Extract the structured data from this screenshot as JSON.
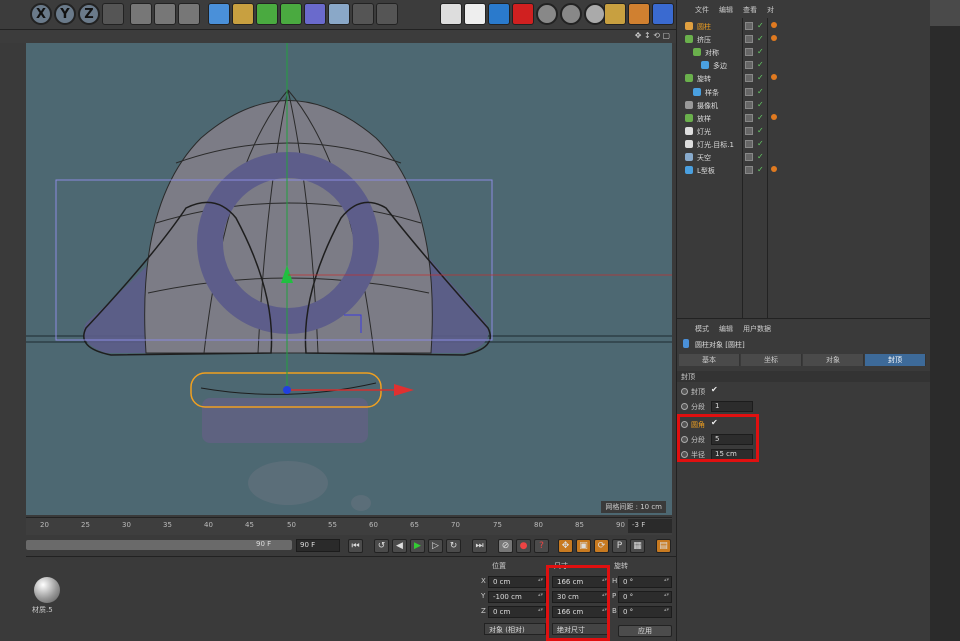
{
  "toolbar": {
    "axis_buttons": [
      "X",
      "Y",
      "Z"
    ]
  },
  "viewport": {
    "grid_spacing_label": "网格间距 : 10 cm"
  },
  "timeline": {
    "ticks": [
      "20",
      "25",
      "30",
      "35",
      "40",
      "45",
      "50",
      "55",
      "60",
      "65",
      "70",
      "75",
      "80",
      "85",
      "90"
    ],
    "current_frame": "-3 F",
    "end_frame_scrub": "90 F",
    "end_frame_field": "90 F"
  },
  "material": {
    "name": "材质.5"
  },
  "coordinates": {
    "headers": {
      "position": "位置",
      "size": "尺寸",
      "rotation": "旋转"
    },
    "axes": [
      "X",
      "Y",
      "Z"
    ],
    "position": [
      "0 cm",
      "-100 cm",
      "0 cm"
    ],
    "size": [
      "166 cm",
      "30 cm",
      "166 cm"
    ],
    "rotation_axes": [
      "H",
      "P",
      "B"
    ],
    "rotation": [
      "0 °",
      "0 °",
      "0 °"
    ],
    "mode_dropdown": "对象 (相对)",
    "size_dropdown": "绝对尺寸",
    "apply_label": "应用"
  },
  "object_manager": {
    "menu": [
      "文件",
      "编辑",
      "查看",
      "对"
    ],
    "objects": [
      {
        "name": "圆柱",
        "indent": 0,
        "color": "#e0a040"
      },
      {
        "name": "挤压",
        "indent": 0,
        "color": "#6ab04c"
      },
      {
        "name": "对称",
        "indent": 1,
        "color": "#6ab04c"
      },
      {
        "name": "多边",
        "indent": 2,
        "color": "#4aa0e0"
      },
      {
        "name": "旋转",
        "indent": 0,
        "color": "#6ab04c"
      },
      {
        "name": "样条",
        "indent": 1,
        "color": "#4aa0e0"
      },
      {
        "name": "摄像机",
        "indent": 0,
        "color": "#999999"
      },
      {
        "name": "放样",
        "indent": 0,
        "color": "#6ab04c"
      },
      {
        "name": "灯光",
        "indent": 0,
        "color": "#dddddd"
      },
      {
        "name": "灯光.目标.1",
        "indent": 0,
        "color": "#dddddd"
      },
      {
        "name": "天空",
        "indent": 0,
        "color": "#88aacc"
      },
      {
        "name": "L型板",
        "indent": 0,
        "color": "#4aa0e0"
      }
    ]
  },
  "attribute_manager": {
    "menu": [
      "模式",
      "编辑",
      "用户数据"
    ],
    "object_title": "圆柱对象 [圆柱]",
    "tabs": [
      "基本",
      "坐标",
      "对象",
      "封顶"
    ],
    "active_tab": "封顶",
    "section": "封顶",
    "params": [
      {
        "label": "封顶",
        "type": "check",
        "value": "✔"
      },
      {
        "label": "分段",
        "type": "field",
        "value": "1"
      },
      {
        "label": "圆角",
        "type": "check",
        "value": "✔"
      },
      {
        "label": "分段",
        "type": "field",
        "value": "5"
      },
      {
        "label": "半径",
        "type": "field",
        "value": "15 cm"
      }
    ]
  },
  "colors": {
    "viewport_bg": "#4d6872",
    "active_tab": "#3d6a99",
    "highlight": "#e01010",
    "selection": "#f0a020"
  }
}
